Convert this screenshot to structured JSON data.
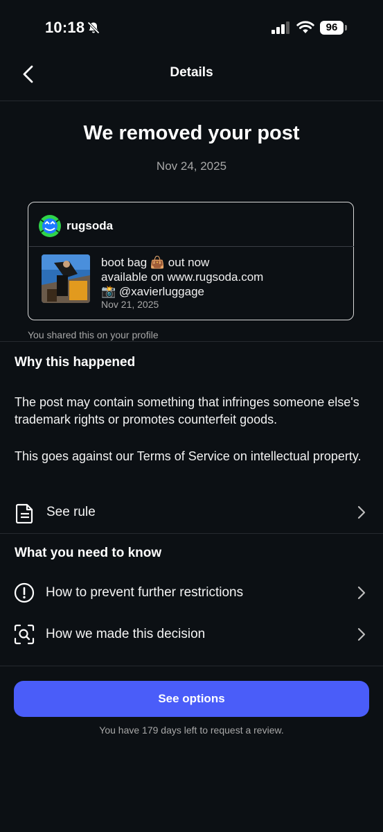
{
  "status_bar": {
    "time": "10:18",
    "battery": "96",
    "icons": [
      "bell-slash-icon",
      "signal-icon",
      "wifi-icon",
      "battery-icon"
    ]
  },
  "header": {
    "title": "Details",
    "back_icon": "chevron-left-icon"
  },
  "notice": {
    "title": "We removed your post",
    "date": "Nov 24, 2025"
  },
  "post": {
    "username": "rugsoda",
    "caption_line1": "boot bag 👜 out now",
    "caption_line2": "available on www.rugsoda.com",
    "caption_line3": "📸 @xavierluggage",
    "date": "Nov 21, 2025",
    "shared_note": "You shared this on your profile"
  },
  "why": {
    "title": "Why this happened",
    "paragraph1": "The post may contain something that infringes someone else's trademark rights or promotes counterfeit goods.",
    "paragraph2": "This goes against our Terms of Service on intellectual property.",
    "see_rule": "See rule"
  },
  "know": {
    "title": "What you need to know",
    "items": [
      {
        "label": "How to prevent further restrictions",
        "icon": "alert-circle-icon"
      },
      {
        "label": "How we made this decision",
        "icon": "scan-search-icon"
      }
    ]
  },
  "footer": {
    "button": "See options",
    "note": "You have 179 days left to request a review."
  },
  "colors": {
    "background": "#0c1014",
    "accent": "#4a5df9",
    "muted_text": "#a8a8a8",
    "divider": "#262a2f"
  }
}
